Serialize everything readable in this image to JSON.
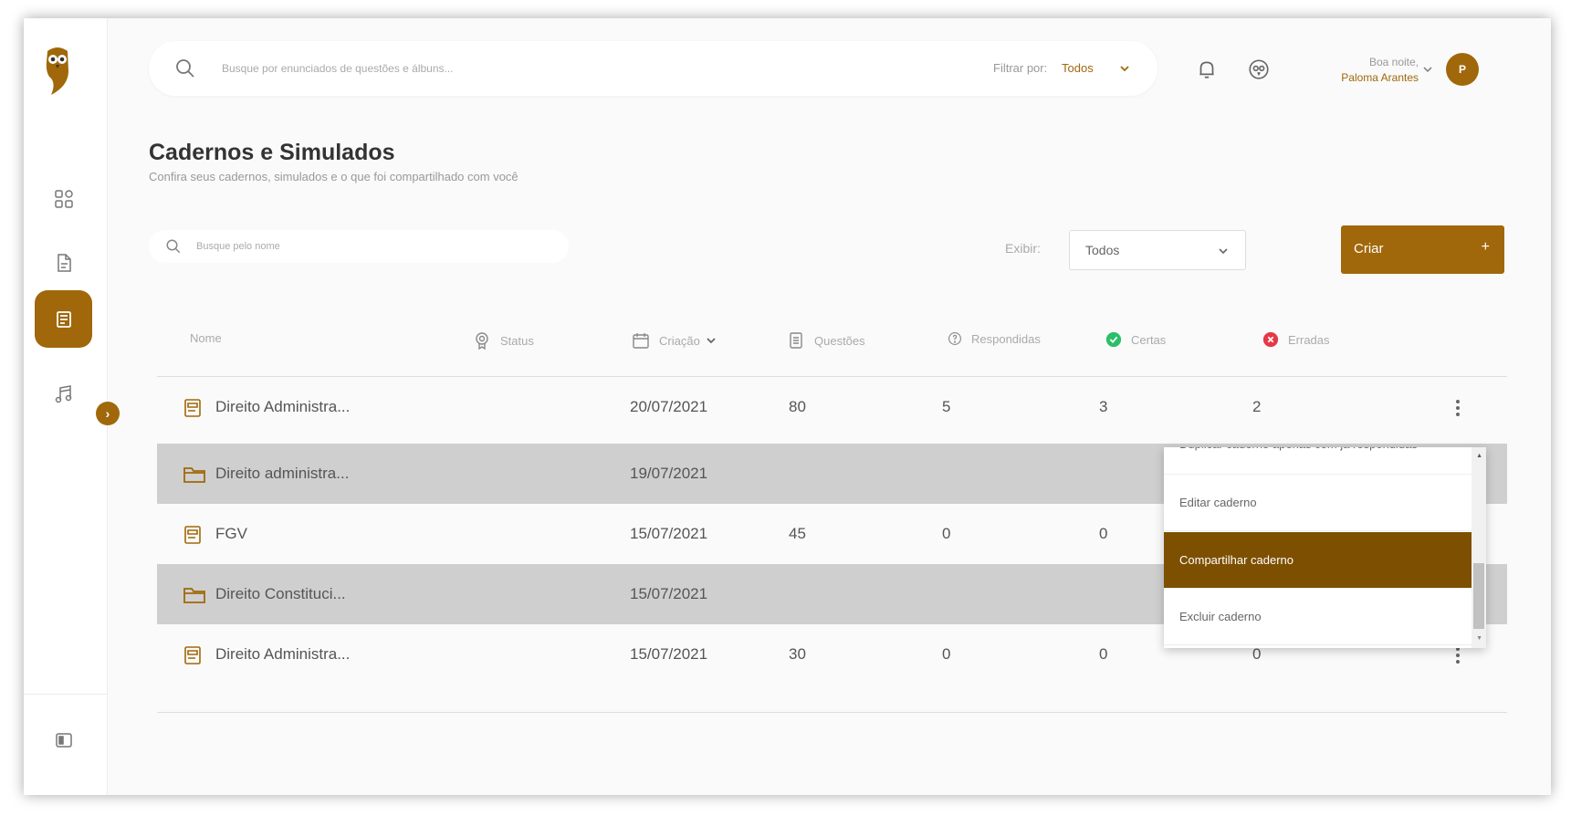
{
  "header": {
    "search_placeholder": "Busque por enunciados de questões e álbuns...",
    "filter_label": "Filtrar por:",
    "filter_value": "Todos",
    "greeting": "Boa noite,",
    "user_name": "Paloma Arantes",
    "avatar_initial": "P"
  },
  "page": {
    "title": "Cadernos e Simulados",
    "subtitle": "Confira seus cadernos, simulados e o que foi compartilhado com você"
  },
  "toolbar": {
    "name_search_placeholder": "Busque pelo nome",
    "show_label": "Exibir:",
    "show_value": "Todos",
    "create_label": "Criar",
    "create_plus": "+"
  },
  "table": {
    "columns": {
      "name": "Nome",
      "status": "Status",
      "created": "Criação",
      "questions": "Questões",
      "answered": "Respondidas",
      "correct": "Certas",
      "wrong": "Erradas"
    },
    "rows": [
      {
        "type": "notebook",
        "name": "Direito Administra...",
        "date": "20/07/2021",
        "questions": "80",
        "answered": "5",
        "correct": "3",
        "wrong": "2"
      },
      {
        "type": "folder",
        "name": "Direito administra...",
        "date": "19/07/2021",
        "questions": "",
        "answered": "",
        "correct": "",
        "wrong": ""
      },
      {
        "type": "notebook",
        "name": "FGV",
        "date": "15/07/2021",
        "questions": "45",
        "answered": "0",
        "correct": "0",
        "wrong": ""
      },
      {
        "type": "folder",
        "name": "Direito Constituci...",
        "date": "15/07/2021",
        "questions": "",
        "answered": "",
        "correct": "",
        "wrong": ""
      },
      {
        "type": "notebook",
        "name": "Direito Administra...",
        "date": "15/07/2021",
        "questions": "30",
        "answered": "0",
        "correct": "0",
        "wrong": "0"
      }
    ]
  },
  "context_menu": {
    "items": [
      "Duplicar caderno apenas com já respondidas",
      "Editar caderno",
      "Compartilhar caderno",
      "Excluir caderno"
    ],
    "active_item": "Compartilhar caderno"
  },
  "colors": {
    "brand": "#a0680a",
    "menu_active": "#7d4f00",
    "correct": "#2bbf6a",
    "wrong": "#e53946",
    "row_shaded": "#cfcfcf"
  },
  "icons": {
    "sidebar": [
      "dashboard-icon",
      "document-icon",
      "notebook-icon",
      "music-icon",
      "panel-toggle-icon"
    ],
    "header": [
      "search-icon",
      "bell-icon",
      "owl-icon",
      "chevron-down-icon"
    ]
  }
}
